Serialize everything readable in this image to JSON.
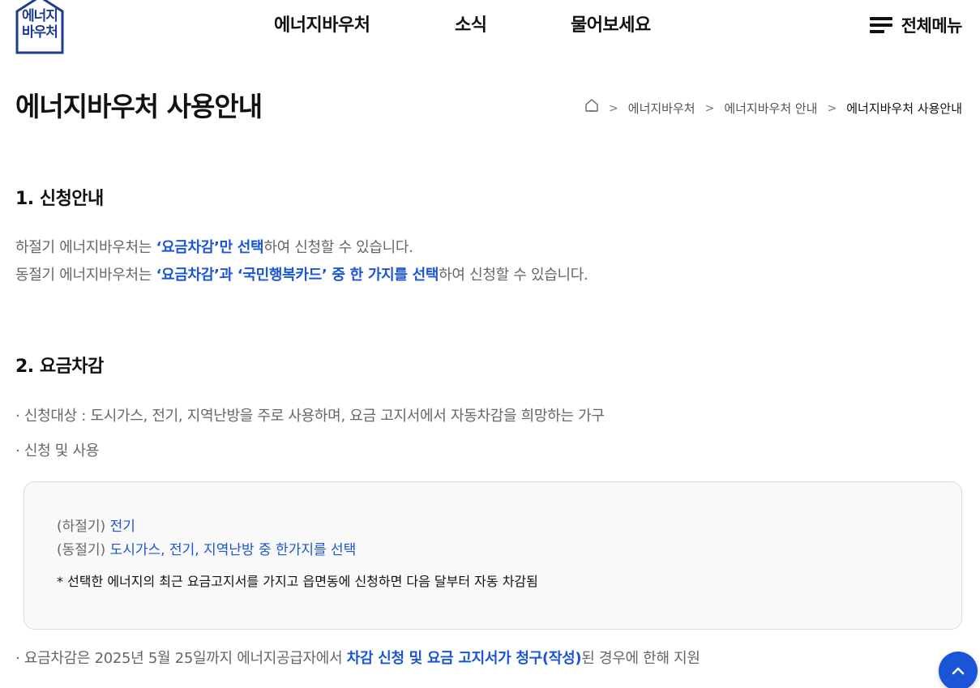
{
  "header": {
    "logo_line1": "에너지",
    "logo_line2": "바우처",
    "nav": [
      "에너지바우처",
      "소식",
      "물어보세요"
    ],
    "all_menu_label": "전체메뉴"
  },
  "page": {
    "title": "에너지바우처 사용안내",
    "breadcrumb": [
      "에너지바우처",
      "에너지바우처 안내",
      "에너지바우처 사용안내"
    ]
  },
  "section1": {
    "title": "1. 신청안내",
    "line1": {
      "a": "하절기 에너지바우처는 ",
      "b": "‘요금차감’만 선택",
      "c": "하여 신청할 수 있습니다."
    },
    "line2": {
      "a": "동절기 에너지바우처는 ",
      "b": "‘요금차감’과 ‘국민행복카드’ 중 한 가지를 선택",
      "c": "하여 신청할 수 있습니다."
    }
  },
  "section2": {
    "title": "2. 요금차감",
    "target": "· 신청대상 : 도시가스, 전기, 지역난방을 주로 사용하며, 요금 고지서에서 자동차감을 희망하는 가구",
    "apply_label": "· 신청 및 사용",
    "box": {
      "summer_label": "(하절기) ",
      "summer_value": "전기",
      "winter_label": "(동절기) ",
      "winter_value": "도시가스, 전기, 지역난방 중 한가지를 선택",
      "note": "* 선택한 에너지의 최근 요금고지서를 가지고 읍면동에 신청하면 다음 달부터 자동 차감됨"
    },
    "deadline": {
      "a": "· 요금차감은 2025년 5월 25일까지 에너지공급자에서 ",
      "b": "차감 신청 및 요금 고지서가 청구(작성)",
      "c": "된 경우에 한해 지원"
    }
  },
  "colors": {
    "accent": "#1a55d8",
    "logo": "#1d3d8f"
  },
  "icons": {
    "home": "home-icon",
    "menu": "hamburger-icon",
    "top": "chevron-up-icon"
  }
}
